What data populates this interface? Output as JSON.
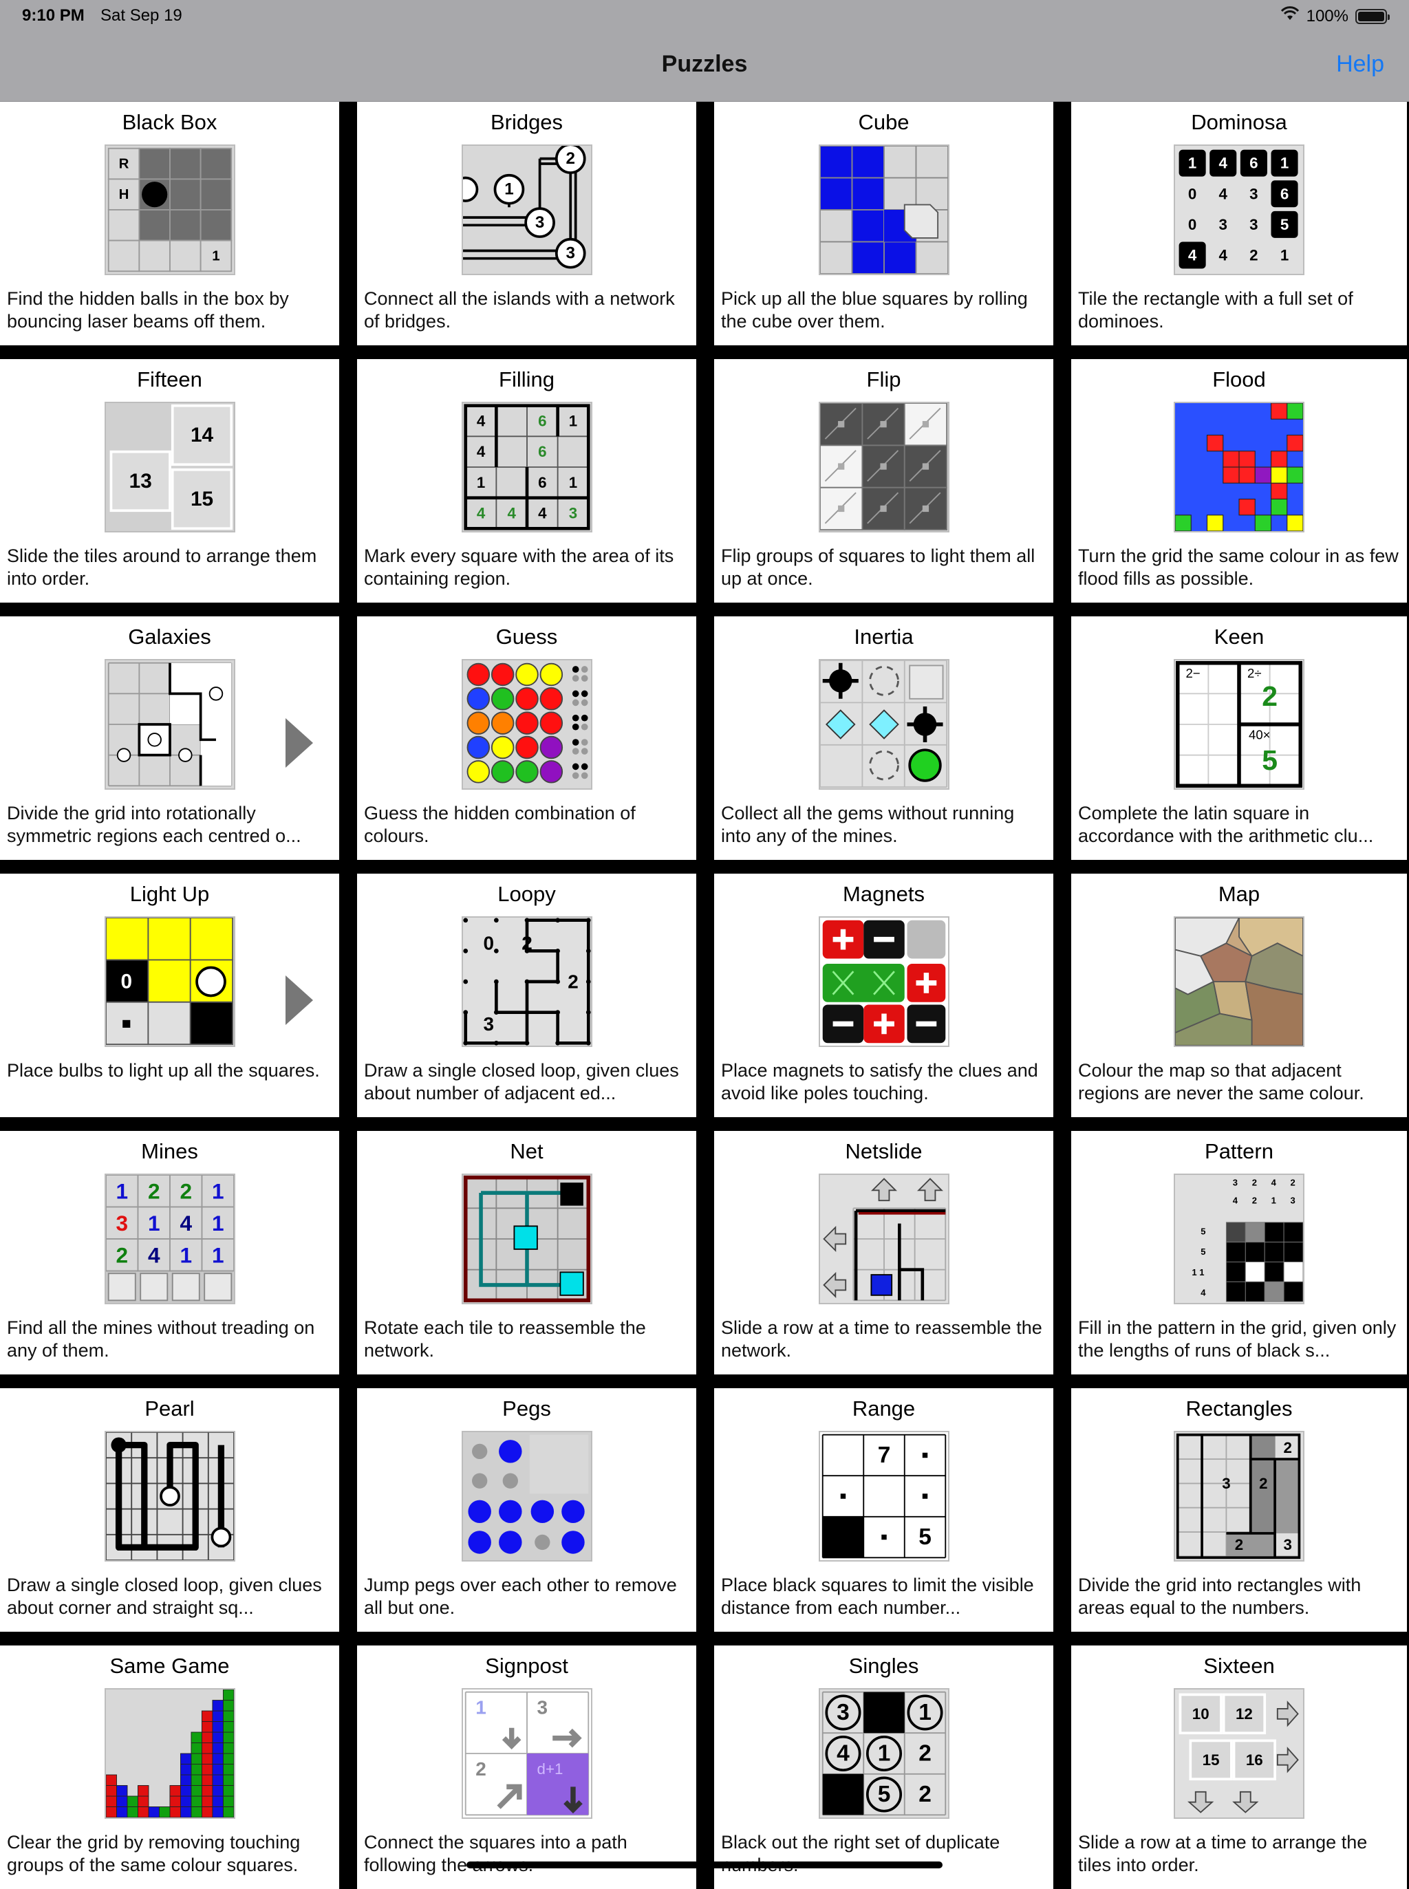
{
  "status": {
    "time": "9:10 PM",
    "date": "Sat Sep 19",
    "battery": "100%"
  },
  "nav": {
    "title": "Puzzles",
    "help": "Help"
  },
  "puzzles": [
    {
      "name": "Black Box",
      "desc": "Find the hidden balls in the box by bouncing laser beams off them.",
      "icon": "black-box"
    },
    {
      "name": "Bridges",
      "desc": "Connect all the islands with a network of bridges.",
      "icon": "bridges"
    },
    {
      "name": "Cube",
      "desc": "Pick up all the blue squares by rolling the cube over them.",
      "icon": "cube"
    },
    {
      "name": "Dominosa",
      "desc": "Tile the rectangle with a full set of dominoes.",
      "icon": "dominosa"
    },
    {
      "name": "Fifteen",
      "desc": "Slide the tiles around to arrange them into order.",
      "icon": "fifteen"
    },
    {
      "name": "Filling",
      "desc": "Mark every square with the area of its containing region.",
      "icon": "filling"
    },
    {
      "name": "Flip",
      "desc": "Flip groups of squares to light them all up at once.",
      "icon": "flip"
    },
    {
      "name": "Flood",
      "desc": "Turn the grid the same colour in as few flood fills as possible.",
      "icon": "flood"
    },
    {
      "name": "Galaxies",
      "desc": "Divide the grid into rotationally symmetric regions each centred o...",
      "icon": "galaxies",
      "chevron": true
    },
    {
      "name": "Guess",
      "desc": "Guess the hidden combination of colours.",
      "icon": "guess"
    },
    {
      "name": "Inertia",
      "desc": "Collect all the gems without running into any of the mines.",
      "icon": "inertia"
    },
    {
      "name": "Keen",
      "desc": "Complete the latin square in accordance with the arithmetic clu...",
      "icon": "keen"
    },
    {
      "name": "Light Up",
      "desc": "Place bulbs to light up all the squares.",
      "icon": "light-up",
      "chevron": true
    },
    {
      "name": "Loopy",
      "desc": "Draw a single closed loop, given clues about number of adjacent ed...",
      "icon": "loopy"
    },
    {
      "name": "Magnets",
      "desc": "Place magnets to satisfy the clues and avoid like poles touching.",
      "icon": "magnets"
    },
    {
      "name": "Map",
      "desc": "Colour the map so that adjacent regions are never the same colour.",
      "icon": "map"
    },
    {
      "name": "Mines",
      "desc": "Find all the mines without treading on any of them.",
      "icon": "mines"
    },
    {
      "name": "Net",
      "desc": "Rotate each tile to reassemble the network.",
      "icon": "net"
    },
    {
      "name": "Netslide",
      "desc": "Slide a row at a time to reassemble the network.",
      "icon": "netslide"
    },
    {
      "name": "Pattern",
      "desc": "Fill in the pattern in the grid, given only the lengths of runs of black s...",
      "icon": "pattern"
    },
    {
      "name": "Pearl",
      "desc": "Draw a single closed loop, given clues about corner and straight sq...",
      "icon": "pearl"
    },
    {
      "name": "Pegs",
      "desc": "Jump pegs over each other to remove all but one.",
      "icon": "pegs"
    },
    {
      "name": "Range",
      "desc": "Place black squares to limit the visible distance from each number...",
      "icon": "range"
    },
    {
      "name": "Rectangles",
      "desc": "Divide the grid into rectangles with areas equal to the numbers.",
      "icon": "rectangles"
    },
    {
      "name": "Same Game",
      "desc": "Clear the grid by removing touching groups of the same colour squares.",
      "icon": "same-game"
    },
    {
      "name": "Signpost",
      "desc": "Connect the squares into a path following the arrows.",
      "icon": "signpost"
    },
    {
      "name": "Singles",
      "desc": "Black out the right set of duplicate numbers.",
      "icon": "singles"
    },
    {
      "name": "Sixteen",
      "desc": "Slide a row at a time to arrange the tiles into order.",
      "icon": "sixteen"
    }
  ],
  "thumb_text": {
    "black_box": [
      "R",
      "H",
      "1"
    ],
    "bridges": [
      "2",
      "1",
      "3",
      "3"
    ],
    "dominosa": [
      "1",
      "4",
      "6",
      "1",
      "0",
      "4",
      "3",
      "6",
      "0",
      "3",
      "3",
      "5",
      "4",
      "4",
      "2",
      "1"
    ],
    "fifteen": [
      "14",
      "13",
      "15"
    ],
    "filling": [
      "4",
      "6",
      "1",
      "4",
      "6",
      "1",
      "6",
      "1",
      "4",
      "4",
      "4",
      "3"
    ],
    "keen": [
      "2−",
      "2÷",
      "2",
      "40×",
      "5"
    ],
    "light_up": [
      "0"
    ],
    "loopy": [
      "0",
      "2",
      "2",
      "3"
    ],
    "mines": [
      "1",
      "2",
      "2",
      "1",
      "3",
      "1",
      "4",
      "1",
      "2",
      "4",
      "1",
      "1"
    ],
    "pattern": [
      "3",
      "2",
      "4",
      "2",
      "4",
      "2",
      "1",
      "3",
      "5",
      "5",
      "1 1",
      "4"
    ],
    "range": [
      "7",
      "5"
    ],
    "rectangles": [
      "2",
      "3",
      "2",
      "2",
      "3"
    ],
    "signpost": [
      "1",
      "3",
      "2",
      "d+1"
    ],
    "singles": [
      "3",
      "1",
      "4",
      "1",
      "2",
      "5",
      "2"
    ],
    "sixteen": [
      "10",
      "12",
      "15",
      "16"
    ]
  },
  "colors": {
    "accent": "#1478f5",
    "bar": "#a8a8ab",
    "separator": "#000000",
    "card": "#ffffff"
  }
}
